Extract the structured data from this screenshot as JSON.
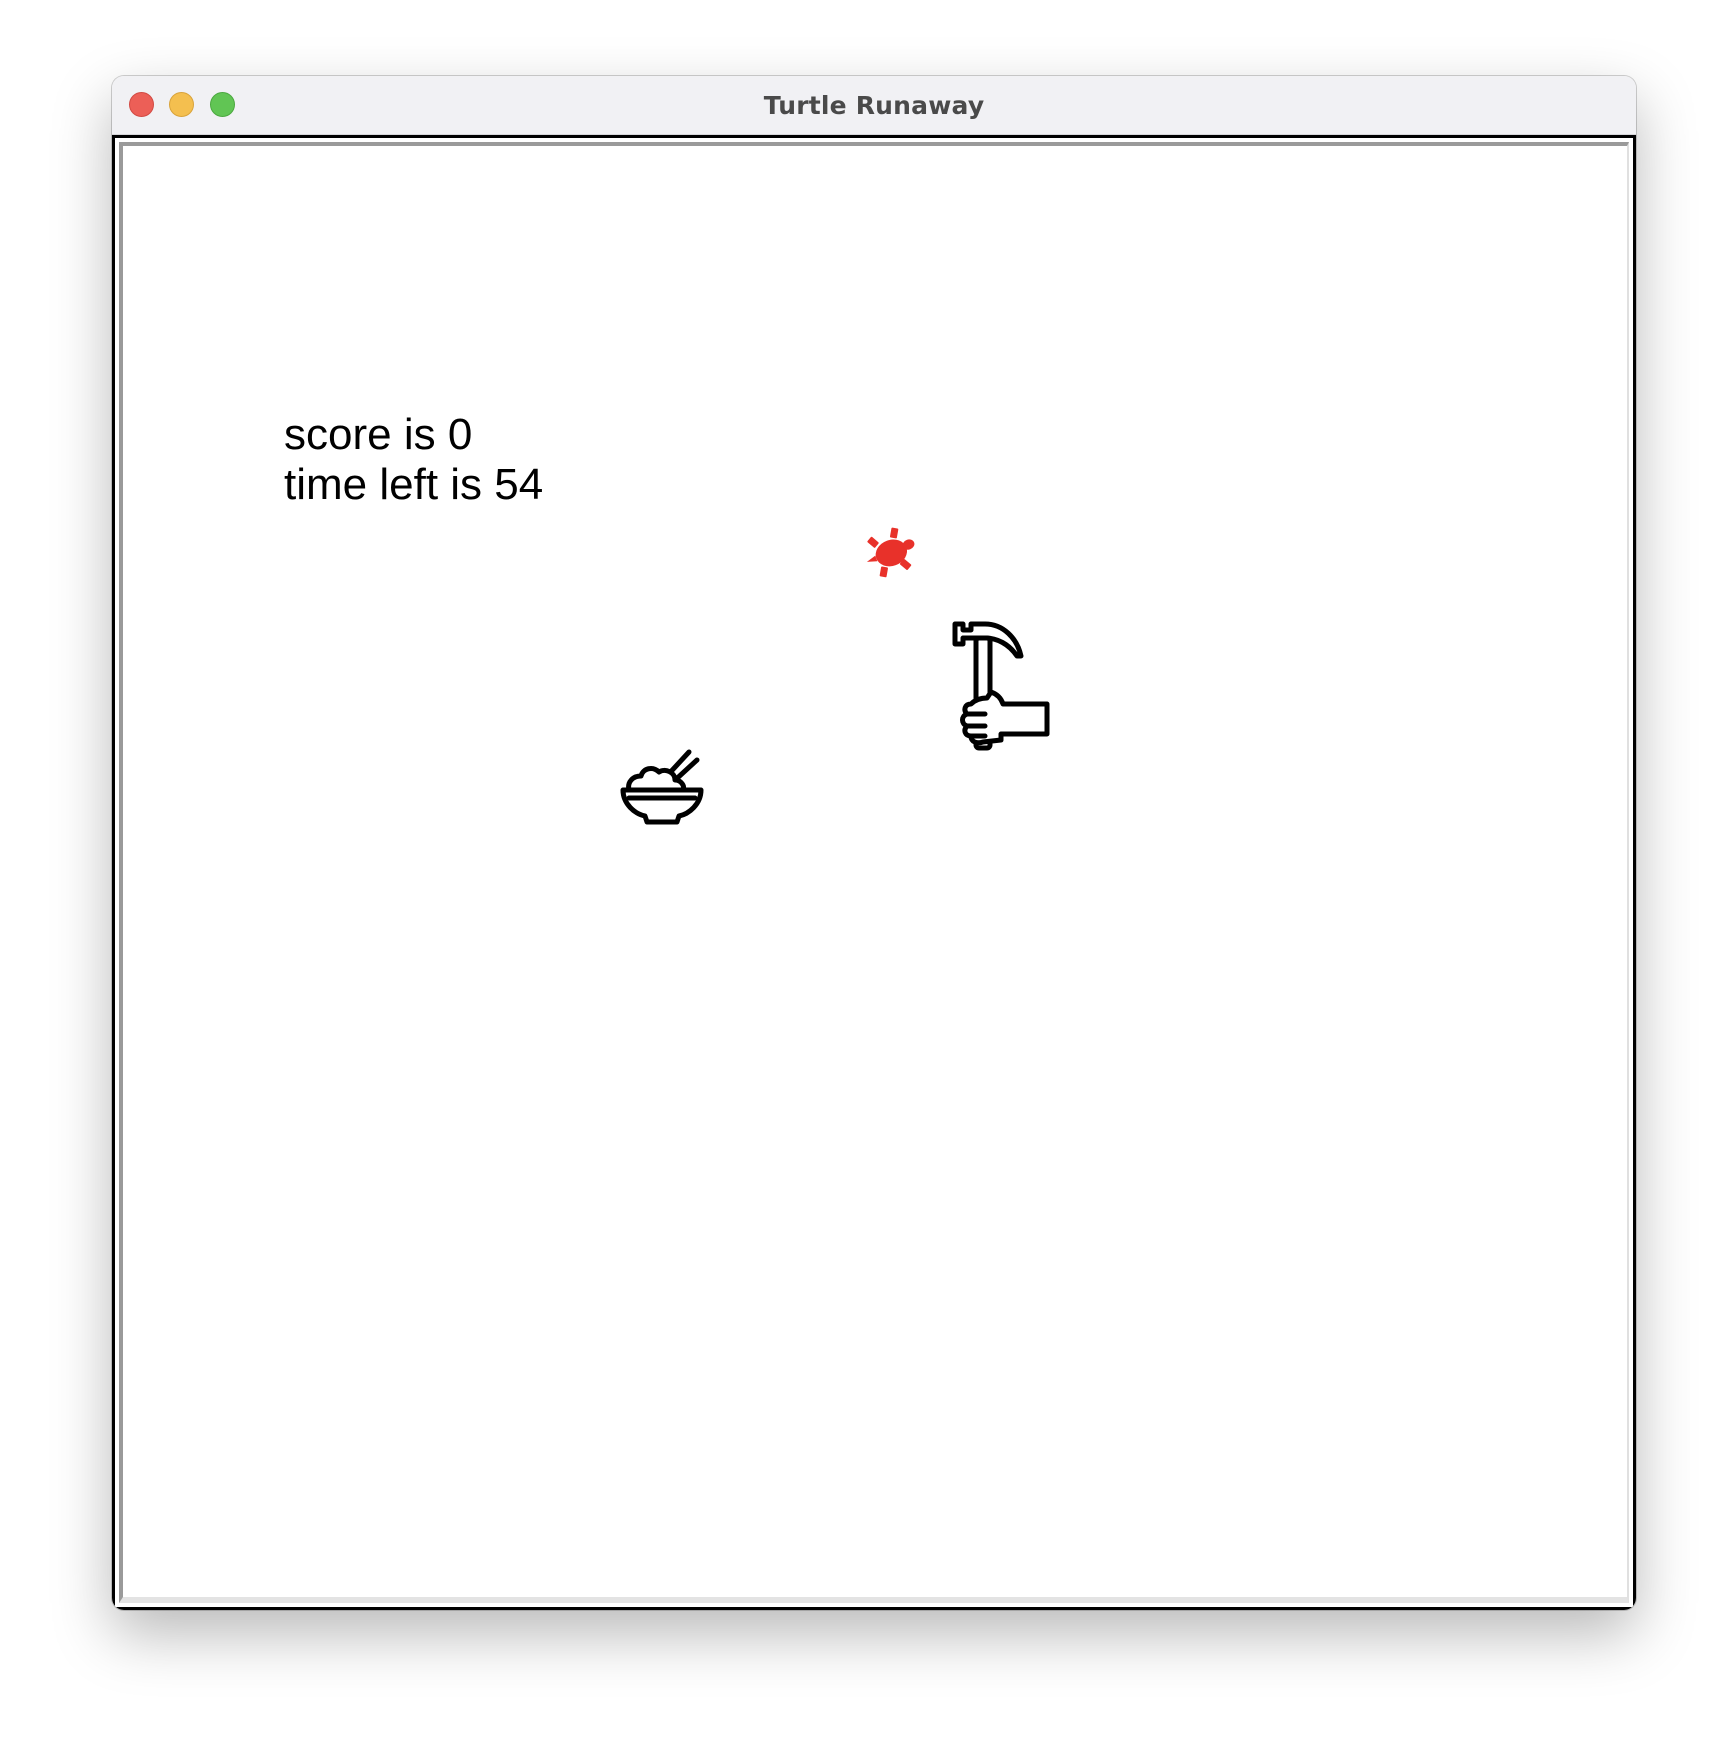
{
  "window": {
    "title": "Turtle Runaway"
  },
  "hud": {
    "score_text": "score is 0",
    "time_text": "time left is 54"
  },
  "sprites": {
    "turtle": {
      "icon": "turtle-icon",
      "color": "#e8312a"
    },
    "hunter": {
      "icon": "hammer-in-hand-icon",
      "color": "#000000"
    },
    "food": {
      "icon": "rice-bowl-with-chopsticks-icon",
      "color": "#000000"
    }
  }
}
